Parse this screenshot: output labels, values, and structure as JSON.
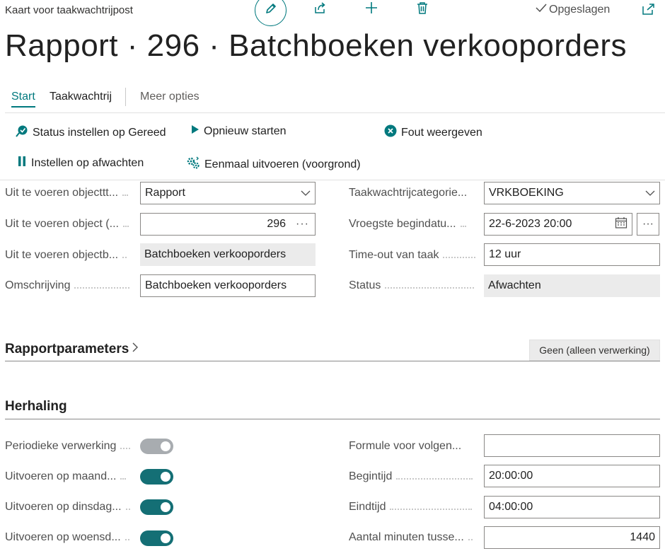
{
  "topbar": {
    "title": "Kaart voor taakwachtrijpost",
    "saved_label": "Opgeslagen"
  },
  "page_title": "Rapport · 296 · Batchboeken verkooporders",
  "nav": {
    "tabs": [
      "Start",
      "Taakwachtrij"
    ],
    "more": "Meer opties"
  },
  "actions": {
    "set_ready": "Status instellen op Gereed",
    "restart": "Opnieuw starten",
    "show_error": "Fout weergeven",
    "set_on_hold": "Instellen op afwachten",
    "run_once": "Eenmaal uitvoeren (voorgrond)"
  },
  "general": {
    "object_type_label": "Uit te voeren objecttt...",
    "object_type_value": "Rapport",
    "object_id_label": "Uit te voeren object (...",
    "object_id_value": "296",
    "object_caption_label": "Uit te voeren objectb...",
    "object_caption_value": "Batchboeken verkooporders",
    "description_label": "Omschrijving",
    "description_value": "Batchboeken verkooporders",
    "category_label": "Taakwachtrijcategorie...",
    "category_value": "VRKBOEKING",
    "earliest_start_label": "Vroegste begindatu...",
    "earliest_start_value": "22-6-2023 20:00",
    "timeout_label": "Time-out van taak",
    "timeout_value": "12 uur",
    "status_label": "Status",
    "status_value": "Afwachten"
  },
  "report_params": {
    "title": "Rapportparameters",
    "button": "Geen (alleen verwerking)"
  },
  "recurrence": {
    "title": "Herhaling",
    "recurring_label": "Periodieke verwerking",
    "recurring_on": false,
    "monday_label": "Uitvoeren op maand...",
    "monday_on": true,
    "tuesday_label": "Uitvoeren op dinsdag...",
    "tuesday_on": true,
    "wednesday_label": "Uitvoeren op woensd...",
    "wednesday_on": true,
    "formula_label": "Formule voor volgen...",
    "formula_value": "",
    "start_time_label": "Begintijd",
    "start_time_value": "20:00:00",
    "end_time_label": "Eindtijd",
    "end_time_value": "04:00:00",
    "minutes_label": "Aantal minuten tusse...",
    "minutes_value": "1440"
  },
  "colors": {
    "accent": "#00797e",
    "toggle_on": "#146f75",
    "toggle_off": "#a8acb0",
    "readonly_bg": "#ebebeb"
  }
}
